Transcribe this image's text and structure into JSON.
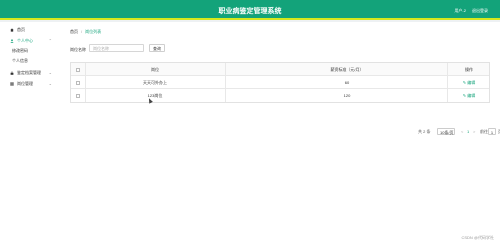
{
  "app": {
    "title": "职业病鉴定管理系统",
    "user": "用户-2",
    "logout": "退出登录"
  },
  "sidebar": {
    "items": [
      {
        "label": "首页",
        "icon": "home-icon"
      },
      {
        "label": "个人中心",
        "icon": "person-icon",
        "expanded": true
      },
      {
        "label": "修改密码",
        "sub": true
      },
      {
        "label": "个人信息",
        "sub": true
      },
      {
        "label": "鉴定档案管理",
        "icon": "lock-icon"
      },
      {
        "label": "岗位管理",
        "icon": "grid-icon"
      }
    ]
  },
  "breadcrumb": {
    "home": "首页",
    "sep": "/",
    "current": "岗位列表"
  },
  "search": {
    "label": "岗位名称",
    "placeholder": "岗位名称",
    "button": "查询"
  },
  "table": {
    "headers": [
      "岗位",
      "薪资标准（元/月）",
      "操作"
    ],
    "rows": [
      {
        "name": "天天可外办上",
        "salary": "60",
        "action": "编辑"
      },
      {
        "name": "123岗位",
        "salary": "120",
        "action": "编辑"
      }
    ]
  },
  "pager": {
    "total": "共 2 条",
    "page_size": "10条/页",
    "prev": "<",
    "page": "1",
    "next": ">",
    "goto": "前往",
    "goto_value": "1",
    "page_unit": "页"
  },
  "watermark": "CSDN @代码学社",
  "colors": {
    "primary": "#13a37a",
    "accent_line": "#d7e81c"
  }
}
